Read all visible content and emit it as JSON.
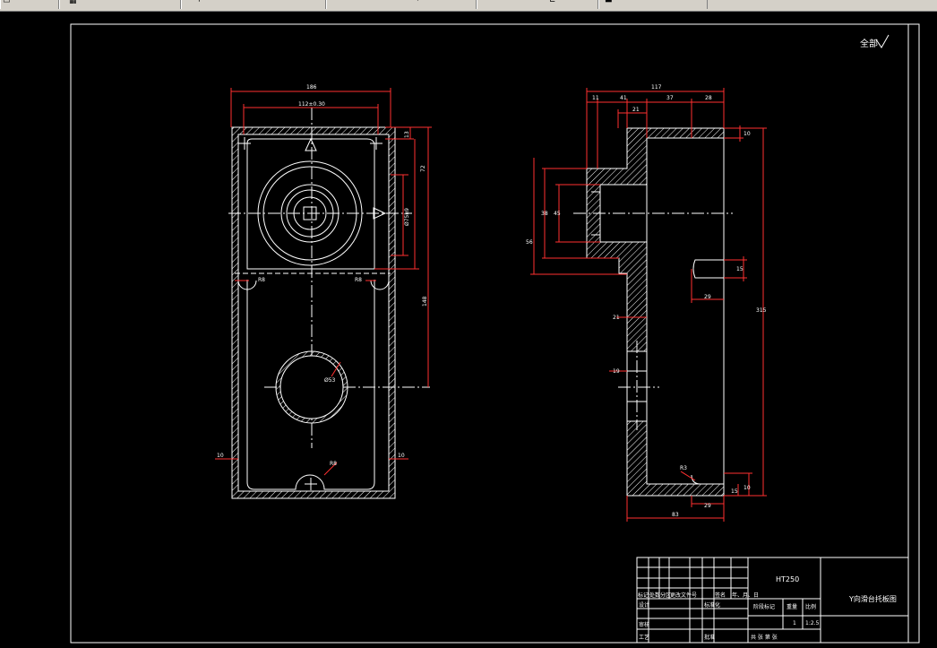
{
  "toolbar": {
    "items": [
      {
        "label": "",
        "icon": "toolbar-icon"
      },
      {
        "label": "",
        "icon": "toolbar-icon"
      },
      {
        "label": "",
        "icon": "toolbar-icon"
      },
      {
        "label": "",
        "icon": "toolbar-icon"
      },
      {
        "label": "",
        "icon": "toolbar-icon"
      },
      {
        "label": "",
        "icon": "toolbar-icon"
      }
    ]
  },
  "drawing": {
    "surface_note": "全部",
    "left_view": {
      "dim_top": "186",
      "dim_tol": "112±0.30",
      "dim_right_small": "13",
      "dim_right_mid": "72",
      "dim_right_bore": "Ø75h9",
      "dim_right_long": "148",
      "fillet_left": "R8",
      "fillet_right": "R8",
      "fillet_bottom": "R8",
      "hole_dia": "Ø53",
      "wall_left": "10",
      "wall_right": "10"
    },
    "right_view": {
      "dim_total": "117",
      "dim_a": "11",
      "dim_b": "41",
      "dim_c": "21",
      "dim_d": "37",
      "dim_e": "28",
      "dim_top_right": "10",
      "dim_v1": "38",
      "dim_v2": "45",
      "dim_v3": "56",
      "dim_slot_h": "15",
      "dim_slot_w": "29",
      "dim_wall": "21",
      "dim_hole": "19",
      "dim_height": "315",
      "fillet": "R3",
      "dim_foot": "29",
      "dim_bottom": "83",
      "dim_br1": "15",
      "dim_br2": "10"
    },
    "title_block": {
      "material": "HT250",
      "drawing_name": "Y向滑台托板图",
      "row_labels": [
        "标记",
        "处数",
        "分区",
        "更改文件号",
        "签名",
        "年、月、日"
      ],
      "roles": [
        "设计",
        "审核",
        "工艺"
      ],
      "std": "标准化",
      "approve": "批准",
      "stage": "阶段标记",
      "weight": "重量",
      "scale": "比例",
      "qty": "1",
      "scale_val": "1:2.5",
      "sheet": "共    张    第    张"
    }
  }
}
